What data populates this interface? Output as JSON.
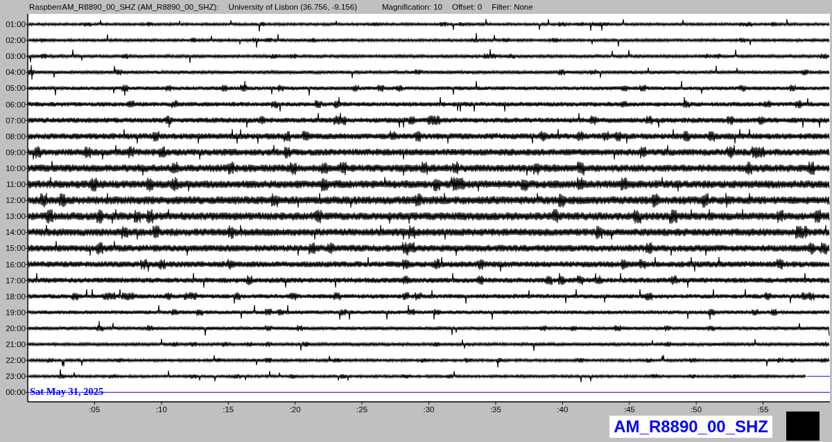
{
  "header": {
    "station": "RaspberrAM_R8890_00_SHZ (AM_R8890_00_SHZ):",
    "location": "University of Lisbon (36.756, -9.156)",
    "magnification": "Magnification: 10",
    "offset": "Offset: 0",
    "filter": "Filter: None"
  },
  "rows": [
    {
      "label": "01:00",
      "kind": "trace"
    },
    {
      "label": "02:00",
      "kind": "trace"
    },
    {
      "label": "03:00",
      "kind": "trace"
    },
    {
      "label": "04:00",
      "kind": "trace"
    },
    {
      "label": "05:00",
      "kind": "trace"
    },
    {
      "label": "06:00",
      "kind": "trace"
    },
    {
      "label": "07:00",
      "kind": "trace"
    },
    {
      "label": "08:00",
      "kind": "trace"
    },
    {
      "label": "09:00",
      "kind": "trace"
    },
    {
      "label": "10:00",
      "kind": "trace"
    },
    {
      "label": "11:00",
      "kind": "trace"
    },
    {
      "label": "12:00",
      "kind": "trace"
    },
    {
      "label": "13:00",
      "kind": "trace"
    },
    {
      "label": "14:00",
      "kind": "trace"
    },
    {
      "label": "15:00",
      "kind": "trace"
    },
    {
      "label": "16:00",
      "kind": "trace"
    },
    {
      "label": "17:00",
      "kind": "trace"
    },
    {
      "label": "18:00",
      "kind": "trace"
    },
    {
      "label": "19:00",
      "kind": "trace"
    },
    {
      "label": "20:00",
      "kind": "trace"
    },
    {
      "label": "21:00",
      "kind": "trace"
    },
    {
      "label": "22:00",
      "kind": "trace"
    },
    {
      "label": "23:00",
      "kind": "partial"
    },
    {
      "label": "00:00",
      "kind": "empty",
      "date": "Sat May 31, 2025"
    }
  ],
  "x_ticks": [
    ":05",
    ":10",
    ":15",
    ":20",
    ":25",
    ":30",
    ":35",
    ":40",
    ":45",
    ":50",
    ":55"
  ],
  "footer": {
    "channel": "AM_R8890_00_SHZ"
  }
}
